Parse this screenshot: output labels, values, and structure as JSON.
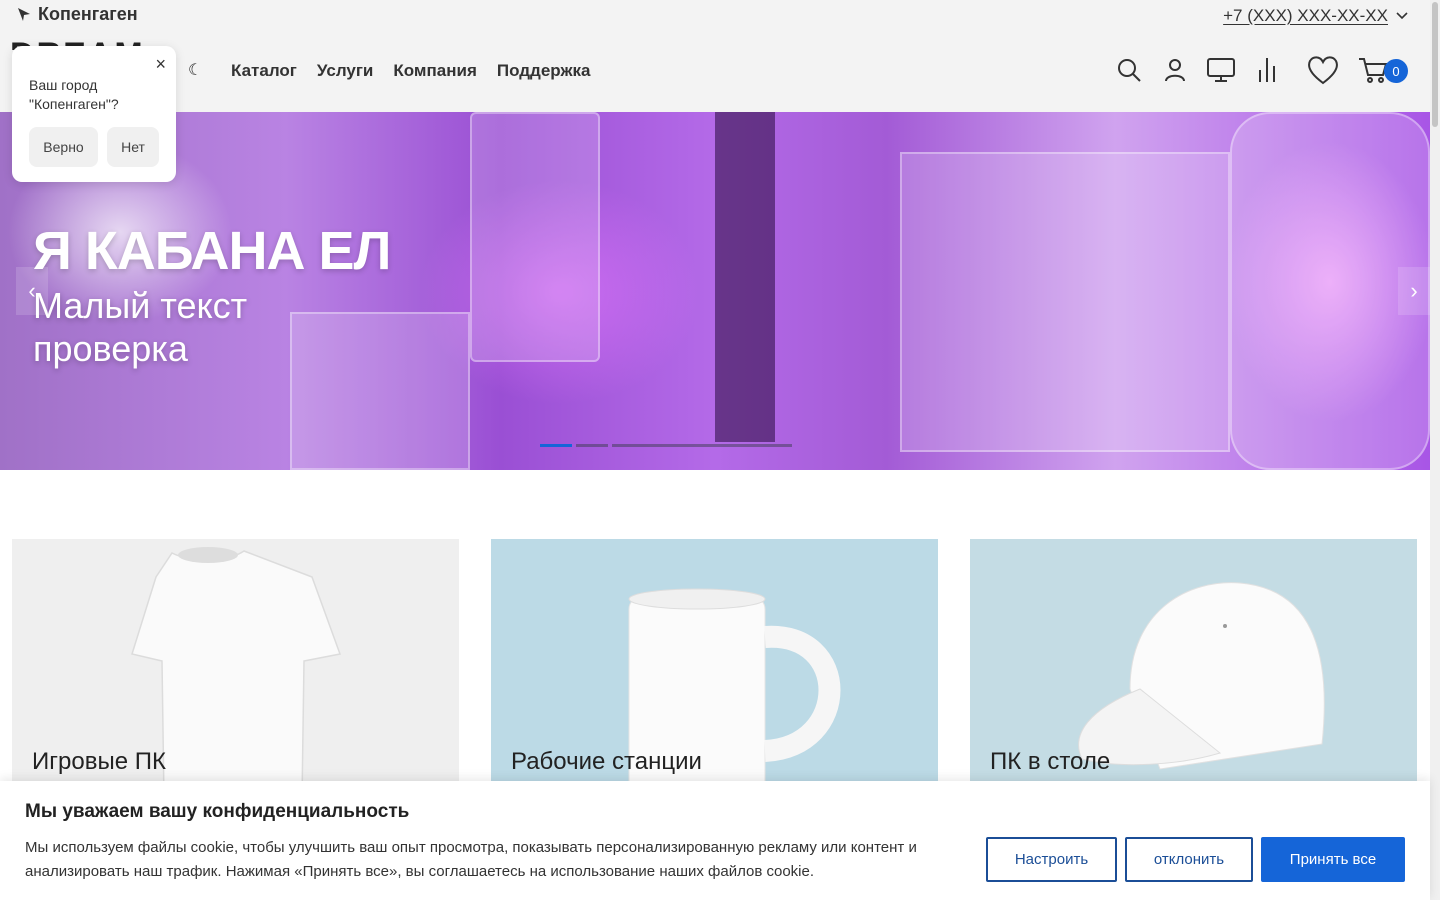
{
  "header": {
    "city": "Копенгаген",
    "phone": "+7 (XXX) XXX-XX-XX",
    "logo_text": "DREAM",
    "nav": [
      "Каталог",
      "Услуги",
      "Компания",
      "Поддержка"
    ],
    "cart_count": "0",
    "icons": [
      "search-icon",
      "user-icon",
      "monitor-icon",
      "compare-icon",
      "heart-icon",
      "cart-icon"
    ]
  },
  "city_popup": {
    "question": "Ваш город \"Копенгаген\"?",
    "yes": "Верно",
    "no": "Нет",
    "close": "×"
  },
  "hero": {
    "title": "Я КАБАНА ЕЛ",
    "subtitle_line1": "Малый текст",
    "subtitle_line2": "проверка",
    "slides": 3,
    "active_slide": 1
  },
  "categories": [
    {
      "title": "Игровые ПК"
    },
    {
      "title": "Рабочие станции"
    },
    {
      "title": "ПК в столе"
    }
  ],
  "cookie": {
    "title": "Мы уважаем вашу конфиденциальность",
    "text": "Мы используем файлы cookie, чтобы улучшить ваш опыт просмотра, показывать персонализированную рекламу или контент и анализировать наш трафик. Нажимая «Принять все», вы соглашаетесь на использование наших файлов cookie.",
    "btn_settings": "Настроить",
    "btn_decline": "отклонить",
    "btn_accept": "Принять все"
  },
  "colors": {
    "accent": "#1565d8",
    "outline_button": "#1b4e97"
  }
}
